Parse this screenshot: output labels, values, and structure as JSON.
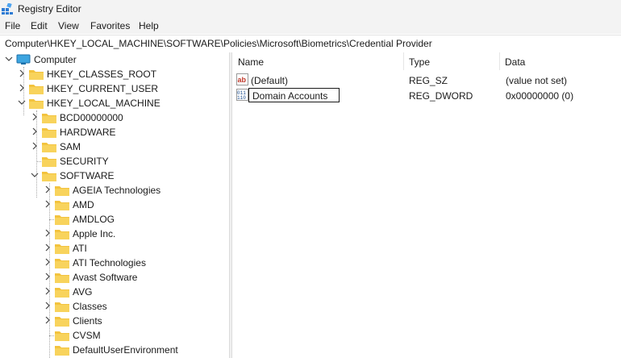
{
  "window": {
    "title": "Registry Editor"
  },
  "menu": [
    "File",
    "Edit",
    "View",
    "Favorites",
    "Help"
  ],
  "address": "Computer\\HKEY_LOCAL_MACHINE\\SOFTWARE\\Policies\\Microsoft\\Biometrics\\Credential Provider",
  "tree": {
    "root": "Computer",
    "hives": [
      "HKEY_CLASSES_ROOT",
      "HKEY_CURRENT_USER",
      "HKEY_LOCAL_MACHINE"
    ],
    "hklm_children": [
      "BCD00000000",
      "HARDWARE",
      "SAM",
      "SECURITY",
      "SOFTWARE"
    ],
    "software_children": [
      "AGEIA Technologies",
      "AMD",
      "AMDLOG",
      "Apple Inc.",
      "ATI",
      "ATI Technologies",
      "Avast Software",
      "AVG",
      "Classes",
      "Clients",
      "CVSM",
      "DefaultUserEnvironment"
    ]
  },
  "list": {
    "columns": [
      "Name",
      "Type",
      "Data"
    ],
    "rows": [
      {
        "name": "(Default)",
        "type": "REG_SZ",
        "data": "(value not set)",
        "icon": "string-value-icon"
      },
      {
        "name": "Domain Accounts",
        "type": "REG_DWORD",
        "data": "0x00000000 (0)",
        "icon": "binary-value-icon",
        "renaming": true
      }
    ]
  },
  "colors": {
    "folder": "#f3c33e",
    "accent": "#0078d4",
    "chrome": "#f3f3f3"
  }
}
